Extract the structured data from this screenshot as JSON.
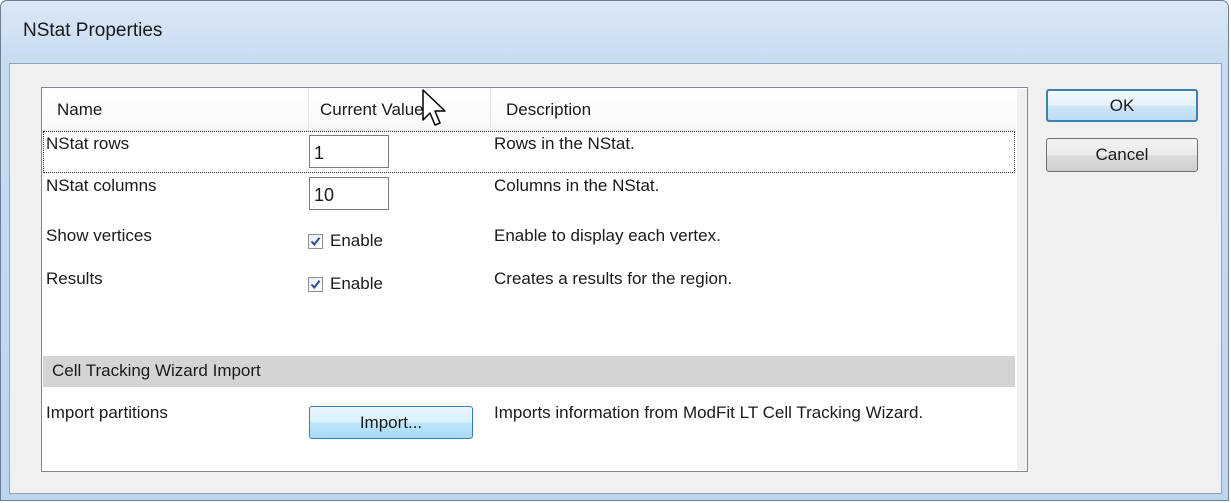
{
  "window": {
    "title": "NStat Properties"
  },
  "grid": {
    "headers": {
      "name": "Name",
      "value": "Current Value",
      "description": "Description"
    },
    "rows": [
      {
        "name": "NStat rows",
        "value": "1",
        "description": "Rows in the NStat."
      },
      {
        "name": "NStat columns",
        "value": "10",
        "description": "Columns in the NStat."
      },
      {
        "name": "Show vertices",
        "value": "Enable",
        "checked": true,
        "description": "Enable to display each vertex."
      },
      {
        "name": "Results",
        "value": "Enable",
        "checked": true,
        "description": "Creates a results for the region."
      }
    ],
    "group": "Cell Tracking Wizard Import",
    "import_row": {
      "name": "Import partitions",
      "button": "Import...",
      "description": "Imports information from ModFit LT Cell Tracking Wizard."
    }
  },
  "buttons": {
    "ok": "OK",
    "cancel": "Cancel"
  },
  "icons": {
    "checkmark": "check-icon",
    "cursor": "mouse-cursor-icon"
  }
}
